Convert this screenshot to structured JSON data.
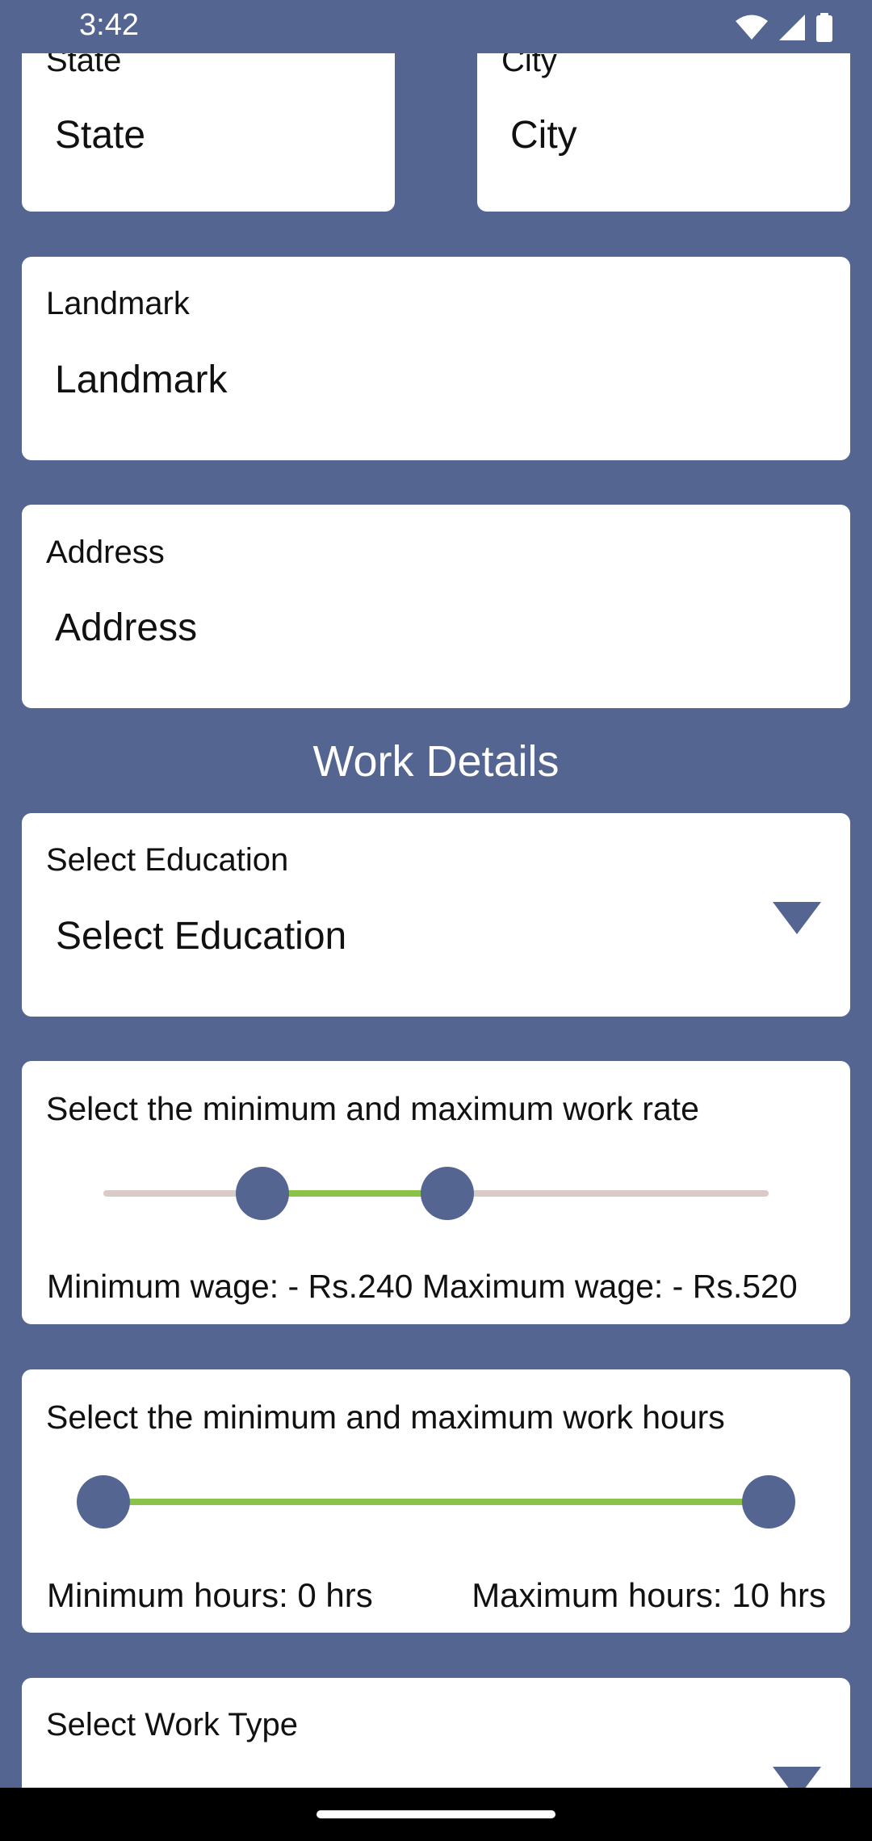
{
  "status_bar": {
    "time": "3:42",
    "icons": [
      "wifi-icon",
      "signal-icon",
      "battery-icon"
    ]
  },
  "location": {
    "state": {
      "label": "State",
      "value": "State"
    },
    "city": {
      "label": "City",
      "value": "City"
    },
    "landmark": {
      "label": "Landmark",
      "value": "Landmark"
    },
    "address": {
      "label": "Address",
      "value": "Address"
    }
  },
  "work_details": {
    "title": "Work Details",
    "education": {
      "label": "Select Education",
      "value": "Select Education",
      "icon": "dropdown-arrow-icon"
    },
    "work_rate": {
      "label": "Select the minimum and maximum work rate",
      "range_text": "Minimum wage: - Rs.240 Maximum wage: - Rs.520",
      "min_value": 240,
      "max_value": 520
    },
    "work_hours": {
      "label": "Select the minimum and maximum work hours",
      "min_text": "Minimum hours: 0 hrs",
      "max_text": "Maximum hours: 10 hrs",
      "min_value": 0,
      "max_value": 10
    },
    "work_type": {
      "label": "Select Work Type",
      "icon": "dropdown-arrow-icon"
    }
  },
  "colors": {
    "background": "#546591",
    "card": "#ffffff",
    "slider_active": "#8bc34a",
    "slider_inactive": "#d9ccc8",
    "thumb": "#546591"
  }
}
